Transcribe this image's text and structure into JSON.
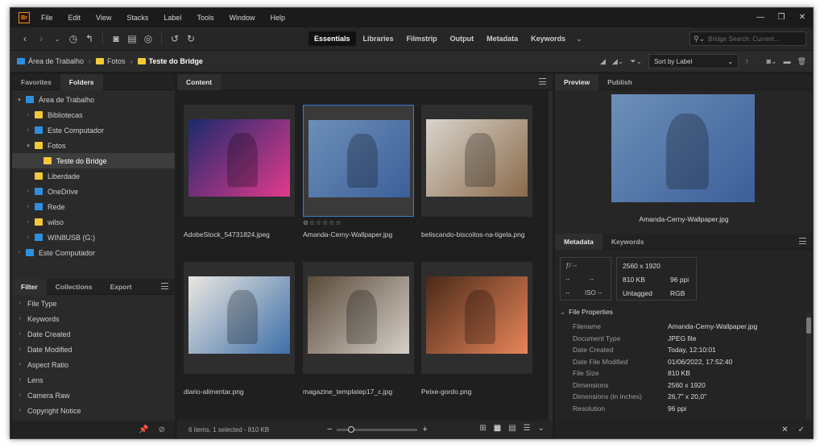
{
  "app": {
    "logo_text": "Br"
  },
  "menu": [
    "File",
    "Edit",
    "View",
    "Stacks",
    "Label",
    "Tools",
    "Window",
    "Help"
  ],
  "workspaces": [
    {
      "label": "Essentials",
      "active": true
    },
    {
      "label": "Libraries",
      "active": false
    },
    {
      "label": "Filmstrip",
      "active": false
    },
    {
      "label": "Output",
      "active": false
    },
    {
      "label": "Metadata",
      "active": false
    },
    {
      "label": "Keywords",
      "active": false
    }
  ],
  "search": {
    "placeholder": "Bridge Search: Current..."
  },
  "breadcrumb": [
    "Área de Trabalho",
    "Fotos",
    "Teste do Bridge"
  ],
  "sort": {
    "label": "Sort by Label"
  },
  "left_tabs": [
    {
      "label": "Favorites",
      "active": false
    },
    {
      "label": "Folders",
      "active": true
    }
  ],
  "folders": [
    {
      "label": "Área de Trabalho",
      "indent": 0,
      "toggle": "▾",
      "icon": "blue"
    },
    {
      "label": "Bibliotecas",
      "indent": 1,
      "toggle": "›",
      "icon": "fold"
    },
    {
      "label": "Este Computador",
      "indent": 1,
      "toggle": "›",
      "icon": "blue"
    },
    {
      "label": "Fotos",
      "indent": 1,
      "toggle": "▾",
      "icon": "fold"
    },
    {
      "label": "Teste do Bridge",
      "indent": 2,
      "toggle": "",
      "icon": "fold",
      "selected": true
    },
    {
      "label": "Liberdade",
      "indent": 1,
      "toggle": "",
      "icon": "fold"
    },
    {
      "label": "OneDrive",
      "indent": 1,
      "toggle": "›",
      "icon": "blue"
    },
    {
      "label": "Rede",
      "indent": 1,
      "toggle": "›",
      "icon": "blue"
    },
    {
      "label": "wilso",
      "indent": 1,
      "toggle": "›",
      "icon": "fold"
    },
    {
      "label": "WIN8USB (G:)",
      "indent": 1,
      "toggle": "›",
      "icon": "blue"
    },
    {
      "label": "Este Computador",
      "indent": 0,
      "toggle": "›",
      "icon": "blue"
    }
  ],
  "filter_tabs": [
    {
      "label": "Filter",
      "active": true
    },
    {
      "label": "Collections",
      "active": false
    },
    {
      "label": "Export",
      "active": false
    }
  ],
  "filters": [
    "File Type",
    "Keywords",
    "Date Created",
    "Date Modified",
    "Aspect Ratio",
    "Lens",
    "Camera Raw",
    "Copyright Notice"
  ],
  "content_tab": "Content",
  "thumbnails": [
    {
      "name": "AdobeStock_54731824.jpeg",
      "selected": false,
      "stars": "",
      "bg": "#1b2a6d",
      "accent": "#e23a8c"
    },
    {
      "name": "Amanda-Cerny-Wallpaper.jpg",
      "selected": true,
      "stars": "⊘☆☆☆☆☆",
      "bg": "#6d8fb8",
      "accent": "#3c5f9a"
    },
    {
      "name": "beliscando-biscoitos-na-tigela.png",
      "selected": false,
      "stars": "",
      "bg": "#d9d4cc",
      "accent": "#8a6a4a"
    },
    {
      "name": "diario-alimentar.png",
      "selected": false,
      "stars": "",
      "bg": "#ebe7e0",
      "accent": "#3d6fa8"
    },
    {
      "name": "magazine_templatep17_c.jpg",
      "selected": false,
      "stars": "",
      "bg": "#5a4a3a",
      "accent": "#d6d0c8"
    },
    {
      "name": "Peixe-gordo.png",
      "selected": false,
      "stars": "",
      "bg": "#4a2a18",
      "accent": "#e8855a"
    }
  ],
  "status": "6 items, 1 selected - 810 KB",
  "zoom_level": 0.15,
  "right_tabs": [
    {
      "label": "Preview",
      "active": true
    },
    {
      "label": "Publish",
      "active": false
    }
  ],
  "preview_name": "Amanda-Cerny-Wallpaper.jpg",
  "meta_tabs": [
    {
      "label": "Metadata",
      "active": true
    },
    {
      "label": "Keywords",
      "active": false
    }
  ],
  "camera": {
    "fstop": "ƒ/ --",
    "shutter": "--",
    "a1": "--",
    "a2": "--",
    "b1": "--",
    "iso": "ISO --"
  },
  "info": {
    "dimensions": "2560 x 1920",
    "size": "810 KB",
    "ppi": "96 ppi",
    "label": "Untagged",
    "mode": "RGB"
  },
  "file_properties_title": "File Properties",
  "file_properties": [
    {
      "key": "Filename",
      "value": "Amanda-Cerny-Wallpaper.jpg"
    },
    {
      "key": "Document Type",
      "value": "JPEG file"
    },
    {
      "key": "Date Created",
      "value": "Today, 12:10:01"
    },
    {
      "key": "Date File Modified",
      "value": "01/06/2022, 17:52:40"
    },
    {
      "key": "File Size",
      "value": "810 KB"
    },
    {
      "key": "Dimensions",
      "value": "2560 x 1920"
    },
    {
      "key": "Dimensions (in inches)",
      "value": "26,7\" x 20,0\""
    },
    {
      "key": "Resolution",
      "value": "96 ppi"
    }
  ],
  "colors": {
    "selection": "#3a7bd5",
    "accent": "#f08a1c"
  }
}
